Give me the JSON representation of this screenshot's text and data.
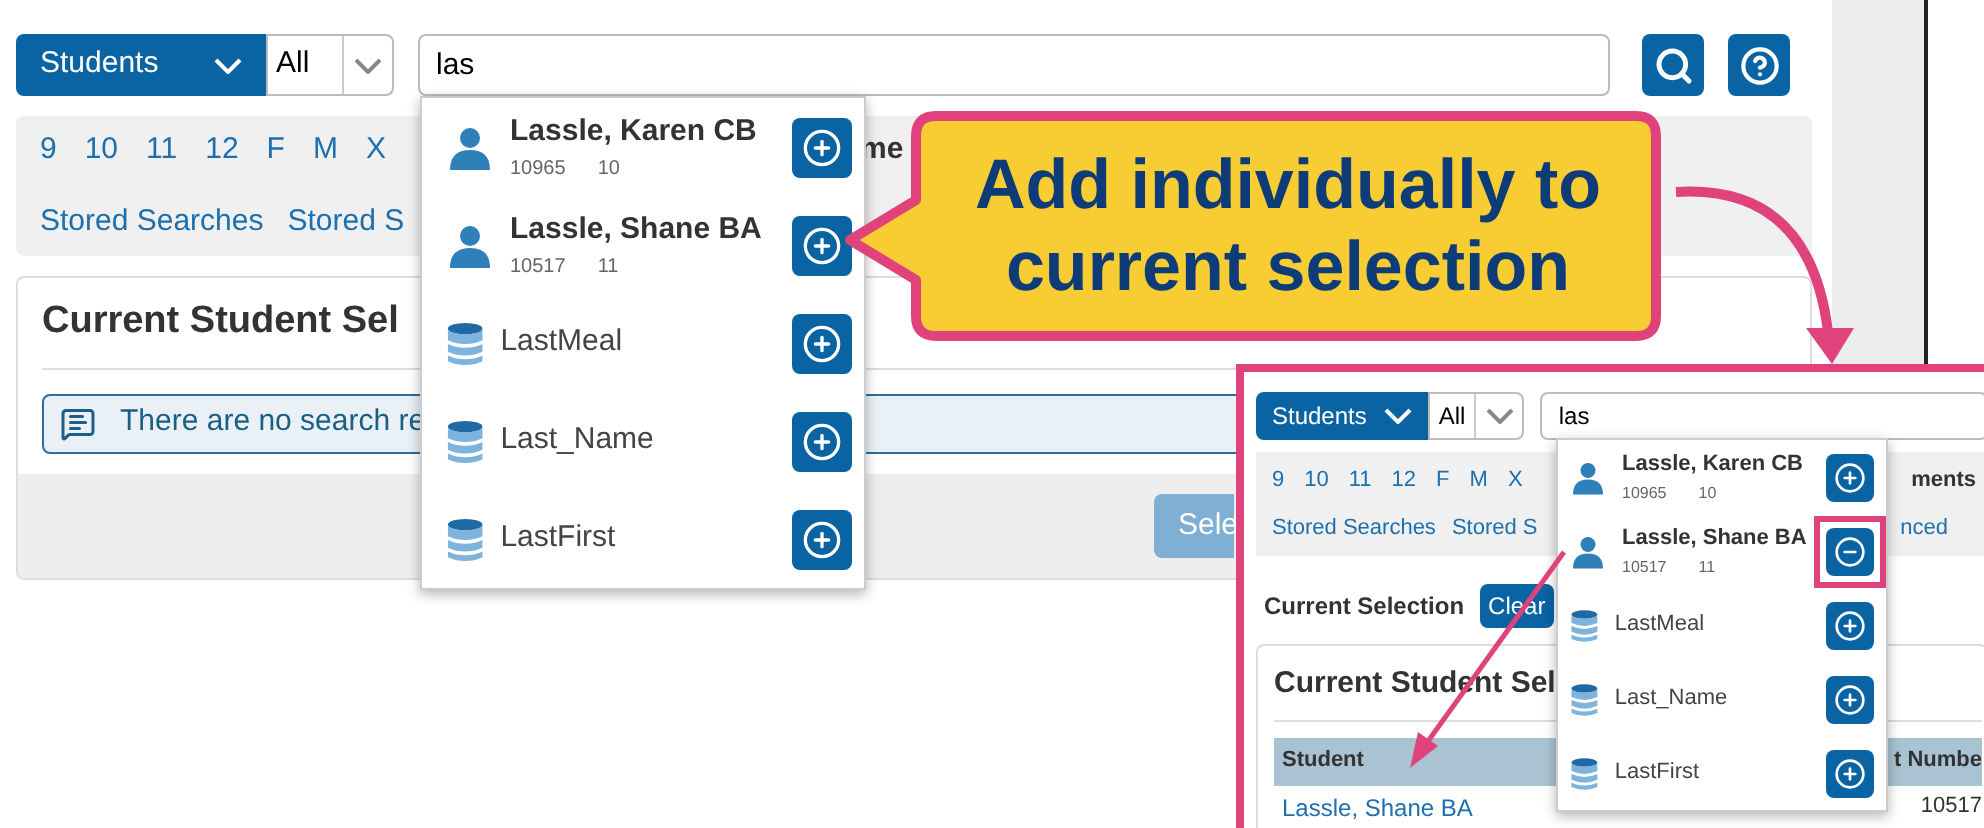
{
  "main": {
    "category": "Students",
    "scope": "All",
    "query": "las",
    "filters": [
      "9",
      "10",
      "11",
      "12",
      "F",
      "M",
      "X"
    ],
    "partial_label": "me",
    "links": [
      "Stored Searches",
      "Stored S"
    ],
    "panel_title": "Current Student Sel",
    "message": "There are no search re",
    "select_button": "Sele",
    "suggestions": [
      {
        "kind": "student",
        "name": "Lassle, Karen CB",
        "id": "10965",
        "grade": "10",
        "added": false,
        "highlighted": false
      },
      {
        "kind": "student",
        "name": "Lassle, Shane BA",
        "id": "10517",
        "grade": "11",
        "added": false,
        "highlighted": false
      },
      {
        "kind": "field",
        "name": "LastMeal",
        "added": false,
        "highlighted": false
      },
      {
        "kind": "field",
        "name": "Last_Name",
        "added": false,
        "highlighted": false
      },
      {
        "kind": "field",
        "name": "LastFirst",
        "added": false,
        "highlighted": false
      }
    ]
  },
  "callout": {
    "text": "Add individually to current selection"
  },
  "inset": {
    "category": "Students",
    "scope": "All",
    "query": "las",
    "filters": [
      "9",
      "10",
      "11",
      "12",
      "F",
      "M",
      "X"
    ],
    "partial_label": "ments",
    "links": [
      "Stored Searches",
      "Stored S"
    ],
    "partial_link": "nced",
    "selection_label": "Current Selection",
    "clear_button": "Clear",
    "panel_title": "Current Student Sel",
    "columns": [
      "Student",
      "t Numbe"
    ],
    "row": [
      "Lassle, Shane BA",
      "10517"
    ],
    "suggestions": [
      {
        "kind": "student",
        "name": "Lassle, Karen CB",
        "id": "10965",
        "grade": "10",
        "added": false,
        "highlighted": false
      },
      {
        "kind": "student",
        "name": "Lassle, Shane BA",
        "id": "10517",
        "grade": "11",
        "added": true,
        "highlighted": true
      },
      {
        "kind": "field",
        "name": "LastMeal",
        "added": false,
        "highlighted": false
      },
      {
        "kind": "field",
        "name": "Last_Name",
        "added": false,
        "highlighted": false
      },
      {
        "kind": "field",
        "name": "LastFirst",
        "added": false,
        "highlighted": false
      }
    ]
  }
}
